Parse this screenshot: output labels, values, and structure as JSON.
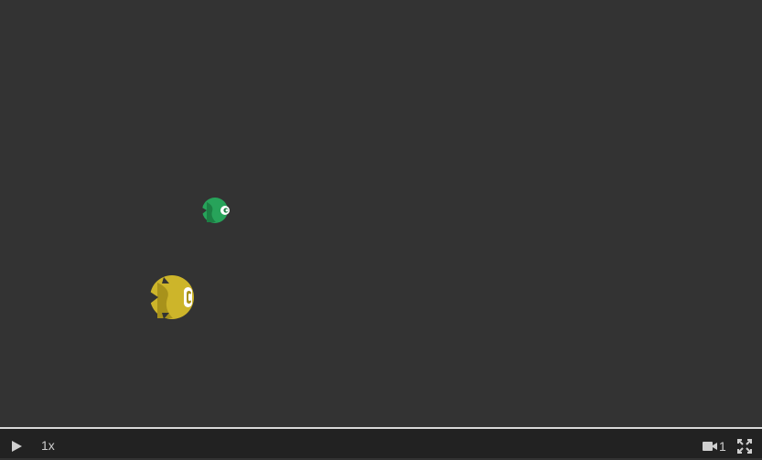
{
  "playback": {
    "speed_label": "1x",
    "camera_count": "1",
    "progress": 1.0
  },
  "agents": [
    {
      "name": "green-agent",
      "color": "#27a35a",
      "accent": "#1c7f44",
      "eye": "#ffffff"
    },
    {
      "name": "yellow-agent",
      "color": "#cdb52a",
      "accent": "#a8921b",
      "eye": "#ffffff"
    }
  ],
  "icons": {
    "play": "play-icon",
    "camera": "camera-icon",
    "fullscreen": "fullscreen-icon"
  },
  "colors": {
    "background": "#333333",
    "controls_bar": "#222222",
    "progress": "#d9d9d9",
    "control_text": "#cfcfcf"
  }
}
